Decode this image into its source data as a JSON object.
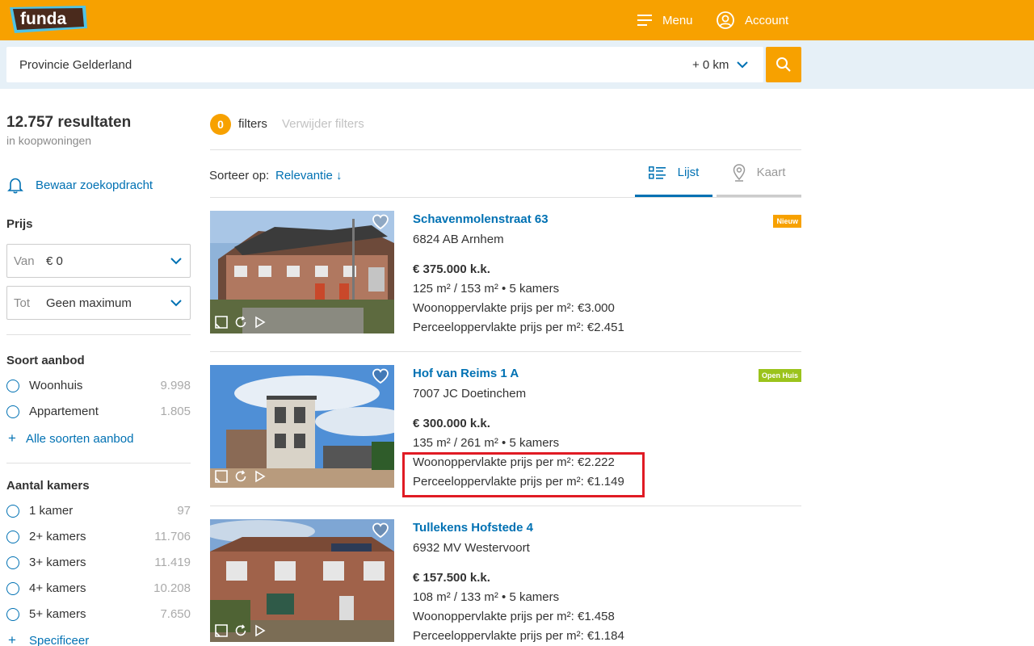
{
  "header": {
    "logo_text": "funda",
    "menu_label": "Menu",
    "account_label": "Account"
  },
  "search": {
    "value": "Provincie Gelderland",
    "radius": "+ 0 km"
  },
  "sidebar": {
    "results_count": "12.757 resultaten",
    "results_sub": "in koopwoningen",
    "save_search": "Bewaar zoekopdracht",
    "price": {
      "heading": "Prijs",
      "from_label": "Van",
      "from_value": "€ 0",
      "to_label": "Tot",
      "to_value": "Geen maximum"
    },
    "offer_type": {
      "heading": "Soort aanbod",
      "options": [
        {
          "label": "Woonhuis",
          "count": "9.998"
        },
        {
          "label": "Appartement",
          "count": "1.805"
        }
      ],
      "more": "Alle soorten aanbod"
    },
    "rooms": {
      "heading": "Aantal kamers",
      "options": [
        {
          "label": "1 kamer",
          "count": "97"
        },
        {
          "label": "2+ kamers",
          "count": "11.706"
        },
        {
          "label": "3+ kamers",
          "count": "11.419"
        },
        {
          "label": "4+ kamers",
          "count": "10.208"
        },
        {
          "label": "5+ kamers",
          "count": "7.650"
        }
      ],
      "more": "Specificeer"
    }
  },
  "toolbar": {
    "filter_count": "0",
    "filters_label": "filters",
    "remove_filters": "Verwijder filters",
    "sort_label": "Sorteer op:",
    "sort_value": "Relevantie ↓",
    "tab_list": "Lijst",
    "tab_map": "Kaart"
  },
  "listings": [
    {
      "title": "Schavenmolenstraat 63",
      "zip": "6824 AB Arnhem",
      "price": "€ 375.000 k.k.",
      "specs": "125 m² / 153 m²  •  5 kamers",
      "woon": "Woonoppervlakte prijs per m²: €3.000",
      "perceel": "Perceeloppervlakte prijs per m²: €2.451",
      "label": "Nieuw"
    },
    {
      "title": "Hof van Reims 1 A",
      "zip": "7007 JC Doetinchem",
      "price": "€ 300.000 k.k.",
      "specs": "135 m² / 261 m²  •  5 kamers",
      "woon": "Woonoppervlakte prijs per m²: €2.222",
      "perceel": "Perceeloppervlakte prijs per m²: €1.149",
      "label": "Open Huis"
    },
    {
      "title": "Tullekens Hofstede 4",
      "zip": "6932 MV Westervoort",
      "price": "€ 157.500 k.k.",
      "specs": "108 m² / 133 m²  •  5 kamers",
      "woon": "Woonoppervlakte prijs per m²: €1.458",
      "perceel": "Perceeloppervlakte prijs per m²: €1.184"
    }
  ],
  "colors": {
    "brand_orange": "#f7a100",
    "link_blue": "#0071b3",
    "highlight_red": "#e01b24",
    "tag_green": "#9bc31c"
  }
}
